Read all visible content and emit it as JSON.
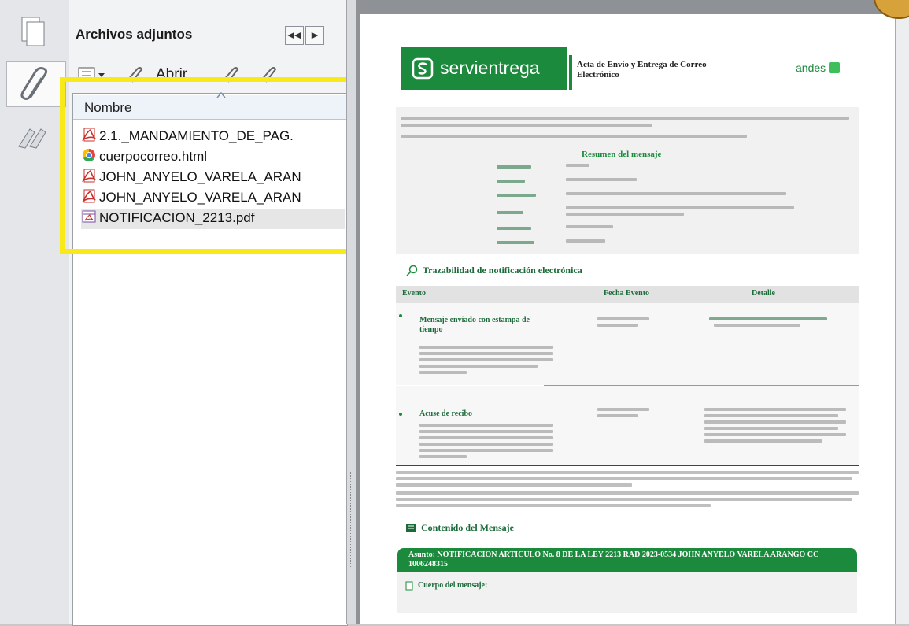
{
  "panel": {
    "title": "Archivos adjuntos",
    "toolbar_open": "Abrir",
    "column_header": "Nombre",
    "files": [
      {
        "name": "2.1._MANDAMIENTO_DE_PAG.",
        "icon": "pdf-icon"
      },
      {
        "name": "cuerpocorreo.html",
        "icon": "chrome-html-icon"
      },
      {
        "name": "JOHN_ANYELO_VARELA_ARAN",
        "icon": "pdf-icon"
      },
      {
        "name": "JOHN_ANYELO_VARELA_ARAN",
        "icon": "pdf-icon"
      },
      {
        "name": "NOTIFICACION_2213.pdf",
        "icon": "pdf-portfolio-icon"
      }
    ]
  },
  "document": {
    "brand": "servientrega",
    "header_title": "Acta de Envío y Entrega de Correo Electrónico",
    "partner": "andes",
    "summary_title": "Resumen del mensaje",
    "trace_title": "Trazabilidad de notificación electrónica",
    "trace_columns": [
      "Evento",
      "Fecha Evento",
      "Detalle"
    ],
    "events": [
      {
        "title": "Mensaje enviado con estampa de tiempo"
      },
      {
        "title": "Acuse de recibo"
      }
    ],
    "content_title": "Contenido del Mensaje",
    "subject": "Asunto: NOTIFICACION ARTICULO No. 8 DE LA LEY 2213 RAD 2023-0534 JOHN ANYELO VARELA ARANGO CC 1006248315",
    "body_label": "Cuerpo del mensaje:"
  },
  "colors": {
    "highlight": "#f8ea18",
    "brand_green": "#1b8a3c"
  }
}
